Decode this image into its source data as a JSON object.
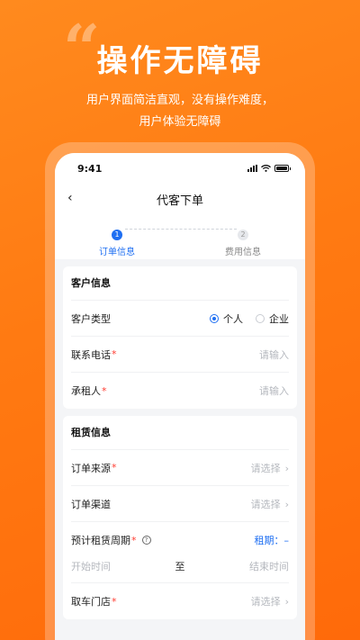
{
  "promo": {
    "quote_mark": "“",
    "title": "操作无障碍",
    "subtitle_line1": "用户界面简洁直观，没有操作难度，",
    "subtitle_line2": "用户体验无障碍"
  },
  "status_bar": {
    "time": "9:41"
  },
  "nav": {
    "back_icon": "‹",
    "title": "代客下单"
  },
  "steps": [
    {
      "num": "1",
      "label": "订单信息",
      "active": true
    },
    {
      "num": "2",
      "label": "费用信息",
      "active": false
    }
  ],
  "customer": {
    "title": "客户信息",
    "type_label": "客户类型",
    "type_options": [
      "个人",
      "企业"
    ],
    "type_selected": "个人",
    "phone_label": "联系电话",
    "phone_placeholder": "请输入",
    "renter_label": "承租人",
    "renter_placeholder": "请输入",
    "required_mark": "*"
  },
  "rental": {
    "title": "租赁信息",
    "source_label": "订单来源",
    "source_placeholder": "请选择",
    "channel_label": "订单渠道",
    "channel_placeholder": "请选择",
    "period_label": "预计租赁周期",
    "help_icon": "?",
    "period_value": "租期：–",
    "start_placeholder": "开始时间",
    "to_label": "至",
    "end_placeholder": "结束时间",
    "pickup_label": "取车门店",
    "pickup_placeholder": "请选择",
    "chevron": "›"
  },
  "colors": {
    "brand": "#ff7a12",
    "accent": "#1f6ff2",
    "required": "#ff3b30"
  }
}
